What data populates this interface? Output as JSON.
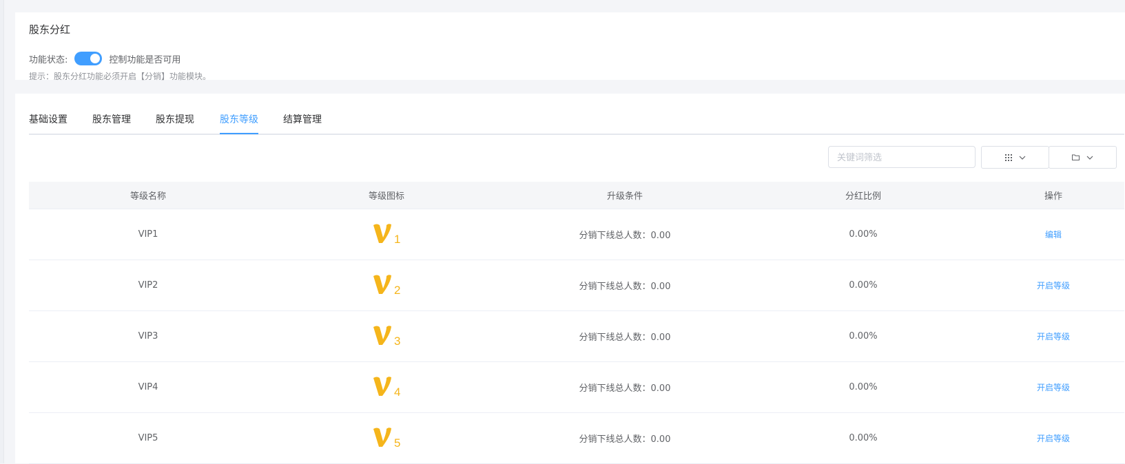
{
  "header": {
    "title": "股东分红",
    "status_label": "功能状态:",
    "toggle_desc": "控制功能是否可用",
    "hint": "提示：股东分红功能必须开启【分销】功能模块。",
    "toggle_on": true,
    "accent": "#409eff"
  },
  "tabs": [
    {
      "label": "基础设置",
      "active": false
    },
    {
      "label": "股东管理",
      "active": false
    },
    {
      "label": "股东提现",
      "active": false
    },
    {
      "label": "股东等级",
      "active": true
    },
    {
      "label": "结算管理",
      "active": false
    }
  ],
  "toolbar": {
    "search_placeholder": "关键词筛选",
    "grid_icon": "grid-icon",
    "folder_icon": "folder-icon"
  },
  "table": {
    "columns": [
      "等级名称",
      "等级图标",
      "升级条件",
      "分红比例",
      "操作"
    ],
    "rows": [
      {
        "name": "VIP1",
        "icon_digit": "1",
        "condition": "分销下线总人数：0.00",
        "ratio": "0.00%",
        "action": "编辑"
      },
      {
        "name": "VIP2",
        "icon_digit": "2",
        "condition": "分销下线总人数：0.00",
        "ratio": "0.00%",
        "action": "开启等级"
      },
      {
        "name": "VIP3",
        "icon_digit": "3",
        "condition": "分销下线总人数：0.00",
        "ratio": "0.00%",
        "action": "开启等级"
      },
      {
        "name": "VIP4",
        "icon_digit": "4",
        "condition": "分销下线总人数：0.00",
        "ratio": "0.00%",
        "action": "开启等级"
      },
      {
        "name": "VIP5",
        "icon_digit": "5",
        "condition": "分销下线总人数：0.00",
        "ratio": "0.00%",
        "action": "开启等级"
      }
    ]
  },
  "icon_color": "#f5b51b"
}
